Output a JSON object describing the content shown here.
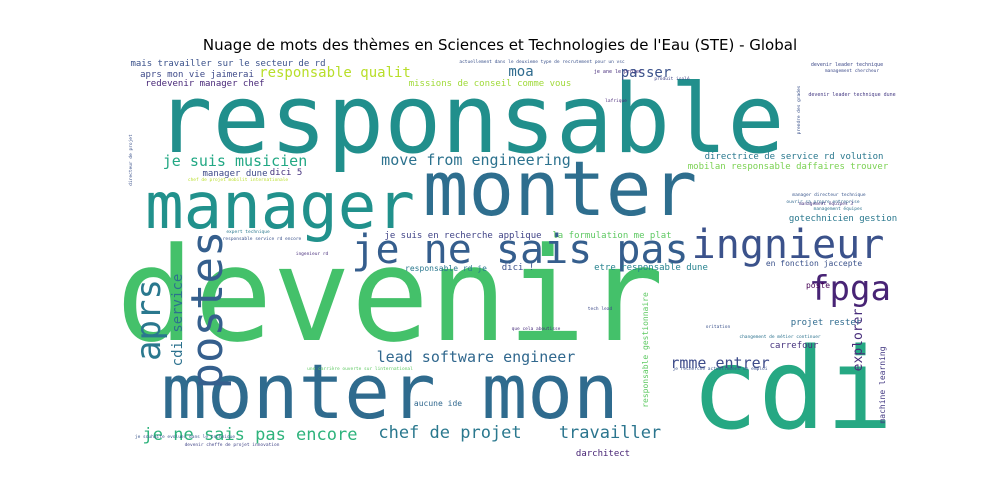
{
  "chart_data": {
    "type": "wordcloud",
    "title": "Nuage de mots des thèmes en Sciences et Technologies de l'Eau (STE) - Global",
    "words": [
      {
        "text": "devenir",
        "color": "#44c16a"
      },
      {
        "text": "responsable",
        "color": "#218f8c"
      },
      {
        "text": "monter",
        "color": "#2e6e8e"
      },
      {
        "text": "cdi",
        "color": "#26a883"
      },
      {
        "text": "monter mon",
        "color": "#2f6b8e"
      },
      {
        "text": "manager",
        "color": "#21918c"
      },
      {
        "text": "je ne sais pas",
        "color": "#355e8d"
      },
      {
        "text": "ingnieur",
        "color": "#3b528b"
      },
      {
        "text": "postes",
        "color": "#355f8d"
      },
      {
        "text": "aprs",
        "color": "#2a788e"
      },
      {
        "text": "fpga",
        "color": "#482475"
      },
      {
        "text": "je ne sais pas encore",
        "color": "#2eb37c"
      },
      {
        "text": "chef de projet",
        "color": "#2a788e"
      },
      {
        "text": "travailler",
        "color": "#2b758e"
      },
      {
        "text": "lead software engineer",
        "color": "#31688e"
      },
      {
        "text": "rmme entrer",
        "color": "#3e4c8a"
      },
      {
        "text": "move from engineering",
        "color": "#2c728e"
      },
      {
        "text": "je suis musicien",
        "color": "#22a884"
      },
      {
        "text": "responsable qualit",
        "color": "#b8de29"
      },
      {
        "text": "moa",
        "color": "#2f6b8e"
      },
      {
        "text": "passer",
        "color": "#3b528b"
      },
      {
        "text": "cdi service",
        "color": "#2c718e"
      },
      {
        "text": "explorer",
        "color": "#472d7b"
      },
      {
        "text": "je suis en recherche applique",
        "color": "#414487"
      },
      {
        "text": "la formulation me plat",
        "color": "#5ec962"
      },
      {
        "text": "gotechnicien gestion",
        "color": "#2a788e"
      },
      {
        "text": "responsable gestionnaire",
        "color": "#5ec962"
      },
      {
        "text": "machine learning",
        "color": "#443a83"
      },
      {
        "text": "mais travailler sur le secteur de rd",
        "color": "#3b528b"
      },
      {
        "text": "aprs mon vie jaimerai",
        "color": "#3e4a89"
      },
      {
        "text": "redevenir manager chef",
        "color": "#482878"
      },
      {
        "text": "missions de conseil comme vous",
        "color": "#a0da39"
      },
      {
        "text": "directrice de service rd volution",
        "color": "#2a788e"
      },
      {
        "text": "mobilan responsable daffaires trouver",
        "color": "#7ad151"
      },
      {
        "text": "manager dune",
        "color": "#3e4a89"
      },
      {
        "text": "dici 5",
        "color": "#46327e"
      },
      {
        "text": "responsable rd je",
        "color": "#2a788e"
      },
      {
        "text": "dici !",
        "color": "#3b528b"
      },
      {
        "text": "etre responsable dune",
        "color": "#26828e"
      },
      {
        "text": "en fonction jaccepte",
        "color": "#3b528b"
      },
      {
        "text": "poste",
        "color": "#440154"
      },
      {
        "text": "projet rester",
        "color": "#2f6b8e"
      },
      {
        "text": "carrefour",
        "color": "#46337e"
      },
      {
        "text": "aucune ide",
        "color": "#31688e"
      },
      {
        "text": "darchitect",
        "color": "#482575"
      },
      {
        "text": "actuellement dans le deuxieme type de recrutement pour un vsc",
        "color": "#3b528b"
      },
      {
        "text": "je ane le projet",
        "color": "#472d7b"
      },
      {
        "text": "devenir leader technique",
        "color": "#3e4a89"
      },
      {
        "text": "devenir leader technique dune",
        "color": "#443983"
      },
      {
        "text": "management chercheur",
        "color": "#3e4c8a"
      },
      {
        "text": "manager directeur technique",
        "color": "#39568c"
      },
      {
        "text": "ouvrir sa propre entreprise",
        "color": "#31688e"
      },
      {
        "text": "management équipes",
        "color": "#2c728e"
      },
      {
        "text": "expert technique",
        "color": "#2a788e"
      },
      {
        "text": "responsable service rd encore",
        "color": "#3b528b"
      },
      {
        "text": "ingenieur rd",
        "color": "#472d7b"
      },
      {
        "text": "tech lead",
        "color": "#3e4a89"
      },
      {
        "text": "oritation",
        "color": "#3b528b"
      },
      {
        "text": "changement de métier continuer",
        "color": "#2c728e"
      },
      {
        "text": "management équipes 3",
        "color": "#46327e"
      },
      {
        "text": "je recherche actuellement un emploi",
        "color": "#3b528b"
      },
      {
        "text": "que cela aboutisse",
        "color": "#472d7b"
      },
      {
        "text": "une carrière ouverte sur linternational",
        "color": "#5ec962"
      },
      {
        "text": "je souhaite evoluer dans le technique",
        "color": "#39568c"
      },
      {
        "text": "devenir cheffe de projet innovation",
        "color": "#414487"
      },
      {
        "text": "directeur de projet",
        "color": "#3b528b"
      },
      {
        "text": "chef de projet mobilit internationale",
        "color": "#b8de29"
      },
      {
        "text": "lafrique",
        "color": "#482878"
      },
      {
        "text": "prendre des grades",
        "color": "#3b528b"
      },
      {
        "text": "produit isolé",
        "color": "#414487"
      }
    ]
  }
}
